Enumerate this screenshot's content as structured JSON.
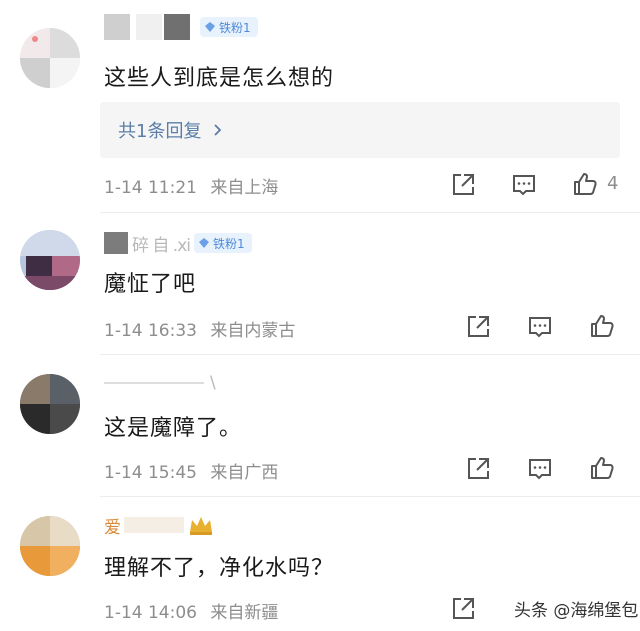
{
  "comments": [
    {
      "name_fragment": "",
      "badge": "铁粉1",
      "text": "这些人到底是怎么想的",
      "reply_label": "共1条回复",
      "time": "1-14 11:21",
      "location": "来自上海",
      "likes": "4"
    },
    {
      "name_fragment": "碎 自 .xi",
      "badge": "铁粉1",
      "text": "魔怔了吧",
      "time": "1-14 16:33",
      "location": "来自内蒙古"
    },
    {
      "name_fragment": "\\",
      "text": "这是魔障了。",
      "time": "1-14 15:45",
      "location": "来自广西"
    },
    {
      "name_fragment": "爱",
      "text": "理解不了，净化水吗？",
      "time": "1-14 14:06",
      "location": "来自新疆"
    }
  ],
  "watermark": "头条 @海绵堡包",
  "icons": {
    "share": "share-icon",
    "comment": "comment-icon",
    "like": "thumbs-up-icon",
    "badge": "diamond-icon",
    "crown": "crown-icon"
  },
  "colors": {
    "badge_bg": "#e8f2fc",
    "badge_text": "#4f8ad8",
    "reply_text": "#5a7ea8",
    "meta_text": "#8d8d8d"
  }
}
